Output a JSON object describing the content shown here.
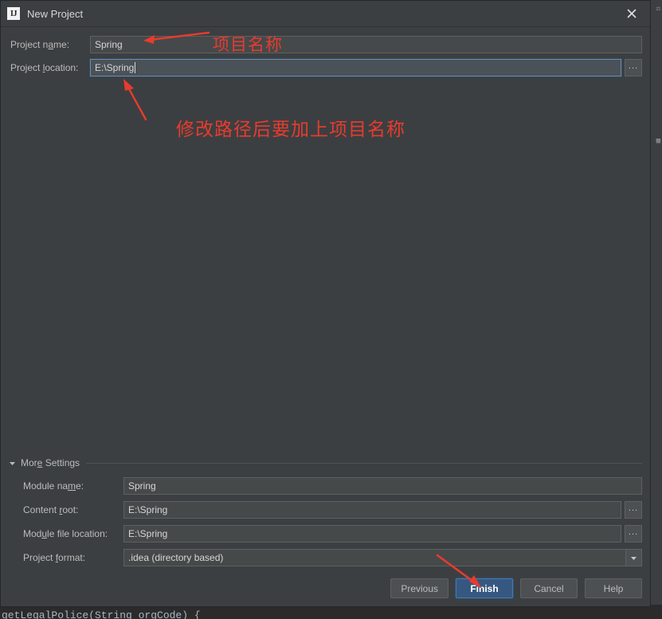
{
  "window": {
    "title": "New Project",
    "logo_text": "IJ",
    "logo_icon": "intellij-idea-logo",
    "close_icon": "close-icon"
  },
  "form": {
    "project_name": {
      "label_before": "Project n",
      "label_mnemonic": "a",
      "label_after": "me:",
      "value": "Spring",
      "placeholder": ""
    },
    "project_location": {
      "label_before": "Project ",
      "label_mnemonic": "l",
      "label_after": "ocation:",
      "value": "E:\\Spring",
      "placeholder": "",
      "browse_label": "...",
      "focused": true
    }
  },
  "more_settings": {
    "label_before": "Mor",
    "label_mnemonic": "e",
    "label_after": " Settings",
    "expanded": true,
    "triangle_icon": "triangle-down-icon",
    "fields": [
      {
        "name": "module-name",
        "label_before": "Module na",
        "label_mnemonic": "m",
        "label_after": "e:",
        "value": "Spring",
        "has_browse": false,
        "has_dropdown": false
      },
      {
        "name": "content-root",
        "label_before": "Content ",
        "label_mnemonic": "r",
        "label_after": "oot:",
        "value": "E:\\Spring",
        "has_browse": true,
        "browse_label": "...",
        "has_dropdown": false
      },
      {
        "name": "module-file-location",
        "label_before": "Mod",
        "label_mnemonic": "u",
        "label_after": "le file location:",
        "value": "E:\\Spring",
        "has_browse": true,
        "browse_label": "...",
        "has_dropdown": false
      },
      {
        "name": "project-format",
        "label_before": "Project ",
        "label_mnemonic": "f",
        "label_after": "ormat:",
        "value": ".idea (directory based)",
        "has_browse": false,
        "has_dropdown": true,
        "dropdown_icon": "chevron-down-icon"
      }
    ]
  },
  "buttons": {
    "previous": "Previous",
    "finish": "Finish",
    "cancel": "Cancel",
    "help": "Help"
  },
  "annotations": {
    "project_name_note": "项目名称",
    "path_note": "修改路径后要加上项目名称",
    "arrow_color": "#e83b2e"
  },
  "background": {
    "code_line": "getLegalPolice(String orgCode) {",
    "code_prefix": ">"
  },
  "colors": {
    "dialog_bg": "#3c3f41",
    "field_bg": "#45494a",
    "field_focused_bg": "#4a5157",
    "button_bg": "#4c5052",
    "default_button_bg": "#365880",
    "text": "#bbbbbb",
    "annotation_red": "#e83b2e",
    "editor_bg": "#2b2b2b"
  }
}
